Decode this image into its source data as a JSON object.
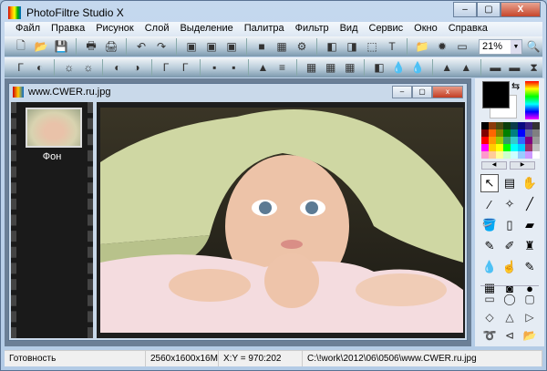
{
  "app": {
    "title": "PhotoFiltre Studio X",
    "minimize": "–",
    "maximize": "▢",
    "close": "X"
  },
  "menu": [
    "Файл",
    "Правка",
    "Рисунок",
    "Слой",
    "Выделение",
    "Палитра",
    "Фильтр",
    "Вид",
    "Сервис",
    "Окно",
    "Справка"
  ],
  "toolbar1": [
    "new-icon",
    "open-icon",
    "save-icon",
    "|",
    "print-icon",
    "scan-icon",
    "|",
    "undo-icon",
    "redo-icon",
    "|",
    "paste-image-icon",
    "duplicate-icon",
    "copy-icon",
    "|",
    "gradient-icon",
    "palette-icon",
    "automate-icon",
    "|",
    "transform-icon",
    "crop-icon",
    "select-icon",
    "text-icon",
    "|",
    "explorer-icon",
    "plugins-icon",
    "preferences-icon"
  ],
  "toolbar1_glyphs": [
    "🗋",
    "📂",
    "💾",
    "|",
    "🖶",
    "🖨",
    "|",
    "↶",
    "↷",
    "|",
    "▣",
    "▣",
    "▣",
    "|",
    "■",
    "▦",
    "⚙",
    "|",
    "◧",
    "◨",
    "⬚",
    "T",
    "|",
    "📁",
    "✹",
    "▭"
  ],
  "zoom": {
    "value": "21%",
    "icon": "zoom-in-icon"
  },
  "toolbar2_glyphs": [
    "Γ",
    "◐",
    "|",
    "☼",
    "☼",
    "|",
    "◐",
    "◑",
    "|",
    "Γ",
    "Γ",
    "|",
    "▪",
    "▪",
    "|",
    "▲",
    "≡",
    "|",
    "▦",
    "▦",
    "▦",
    "|",
    "◧",
    "💧",
    "💧",
    "|",
    "▲",
    "▲",
    "|",
    "▬",
    "▬",
    "⧗"
  ],
  "document": {
    "title": "www.CWER.ru.jpg",
    "layer": "Фон"
  },
  "palette": [
    "#000000",
    "#8b3a0a",
    "#4a4a10",
    "#0b3d0b",
    "#0b3b4a",
    "#0b0b80",
    "#3a2080",
    "#333333",
    "#800000",
    "#ff6600",
    "#808000",
    "#008000",
    "#008080",
    "#0000ff",
    "#666699",
    "#808080",
    "#ff0000",
    "#ff9900",
    "#99cc00",
    "#339966",
    "#33cccc",
    "#3366ff",
    "#800080",
    "#999999",
    "#ff00ff",
    "#ffcc00",
    "#ffff00",
    "#00ff00",
    "#00ffff",
    "#00ccff",
    "#993366",
    "#c0c0c0",
    "#ff99cc",
    "#ffcc99",
    "#ffff99",
    "#ccffcc",
    "#ccffff",
    "#99ccff",
    "#cc99ff",
    "#ffffff"
  ],
  "tools": [
    [
      "pointer-icon",
      "↖"
    ],
    [
      "selection-icon",
      "▤"
    ],
    [
      "hand-icon",
      "✋"
    ],
    [
      "eyedropper-icon",
      "⁄"
    ],
    [
      "magic-wand-icon",
      "✧"
    ],
    [
      "line-icon",
      "╱"
    ],
    [
      "fill-icon",
      "🪣"
    ],
    [
      "spray-icon",
      "▯"
    ],
    [
      "eraser-icon",
      "▰"
    ],
    [
      "brush-icon",
      "✎"
    ],
    [
      "advanced-brush-icon",
      "✐"
    ],
    [
      "stamp-icon",
      "♜"
    ],
    [
      "blur-icon",
      "💧"
    ],
    [
      "smudge-icon",
      "☝"
    ],
    [
      "deform-icon",
      "✎"
    ],
    [
      "pattern-icon",
      "▦"
    ],
    [
      "image-icon",
      "◙"
    ],
    [
      "strawberry-icon",
      "●"
    ]
  ],
  "shapes": [
    [
      "rectangle-icon",
      "▭"
    ],
    [
      "ellipse-icon",
      "◯"
    ],
    [
      "rounded-rect-icon",
      "▢"
    ],
    [
      "diamond-icon",
      "◇"
    ],
    [
      "triangle-icon",
      "△"
    ],
    [
      "triangle-right-icon",
      "▷"
    ],
    [
      "lasso-icon",
      "➰"
    ],
    [
      "polygon-lasso-icon",
      "⊲"
    ],
    [
      "open-folder-icon",
      "📂"
    ]
  ],
  "status": {
    "state": "Готовность",
    "size": "2560x1600x16M",
    "coords": "X:Y = 970:202",
    "path": "C:\\!work\\2012\\06\\0506\\www.CWER.ru.jpg"
  }
}
